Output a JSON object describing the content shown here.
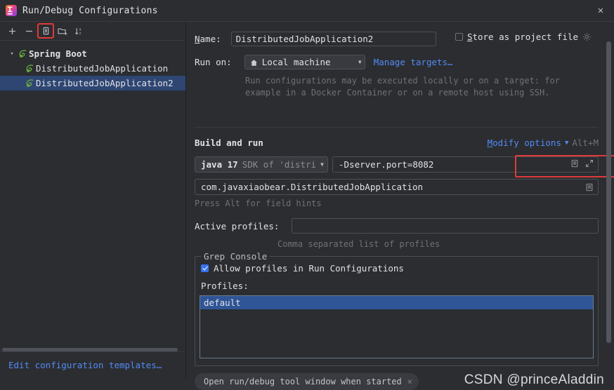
{
  "window": {
    "title": "Run/Debug Configurations",
    "app_icon": "intellij-idea-icon",
    "close_label": "✕"
  },
  "sidebar": {
    "toolbar": [
      {
        "name": "add-configuration-button",
        "icon": "plus-icon",
        "label": "+",
        "selected": false
      },
      {
        "name": "remove-configuration-button",
        "icon": "minus-icon",
        "label": "−",
        "selected": false
      },
      {
        "name": "copy-configuration-button",
        "icon": "copy-icon",
        "label": "",
        "selected": true
      },
      {
        "name": "new-folder-button",
        "icon": "folder-add-icon",
        "label": "",
        "selected": false
      },
      {
        "name": "sort-configurations-button",
        "icon": "sort-alphabetical-icon",
        "label": "",
        "selected": false
      }
    ],
    "tree": [
      {
        "label": "Spring Boot",
        "level": 0,
        "expanded": true,
        "selected": false,
        "icon": "spring-boot-icon"
      },
      {
        "label": "DistributedJobApplication",
        "level": 1,
        "expanded": false,
        "selected": false,
        "icon": "spring-boot-icon"
      },
      {
        "label": "DistributedJobApplication2",
        "level": 1,
        "expanded": false,
        "selected": true,
        "icon": "spring-boot-icon"
      }
    ],
    "footer_link": "Edit configuration templates…"
  },
  "form": {
    "name_label": "Name:",
    "name_label_mnemonic": "N",
    "name_value": "DistributedJobApplication2",
    "store_as_project_file": {
      "label": "Store as project file",
      "mnemonic": "S",
      "checked": false,
      "gear_icon": "gear-icon"
    },
    "run_on_label": "Run on:",
    "run_on_value": "Local machine",
    "run_on_icon": "home-icon",
    "manage_targets_link": "Manage targets…",
    "run_on_description_line1": "Run configurations may be executed locally or on a target: for",
    "run_on_description_line2": "example in a Docker Container or on a remote host using SSH.",
    "build_and_run_title": "Build and run",
    "modify_options_link": "Modify options",
    "modify_options_mnemonic": "M",
    "modify_options_shortcut": "Alt+M",
    "sdk_name": "java 17",
    "sdk_description": "SDK of 'distri",
    "vm_options_value": "-Dserver.port=8082",
    "vm_options_icons": [
      "list-icon",
      "expand-icon"
    ],
    "main_class_value": "com.javaxiaobear.DistributedJobApplication",
    "main_class_icon": "list-icon",
    "alt_hint": "Press Alt for field hints",
    "active_profiles_label": "Active profiles:",
    "active_profiles_value": "",
    "active_profiles_hint": "Comma separated list of profiles",
    "grep_console": {
      "title": "Grep Console",
      "allow_profiles_label": "Allow profiles in Run Configurations",
      "allow_profiles_checked": true,
      "profiles_label": "Profiles:",
      "profiles_list": [
        {
          "label": "default",
          "selected": true
        }
      ]
    },
    "chip_label": "Open run/debug tool window when started",
    "chip_close": "×"
  },
  "watermark": "CSDN @princeAladdin",
  "colors": {
    "background": "#2b2d30",
    "accent_blue": "#548af7",
    "checkbox_blue": "#3574f0",
    "selection_blue": "#2f4673",
    "list_selection_blue": "#2f5596",
    "highlight_red": "#e03a3a",
    "border": "#4e5157",
    "muted_text": "#6e7177"
  }
}
